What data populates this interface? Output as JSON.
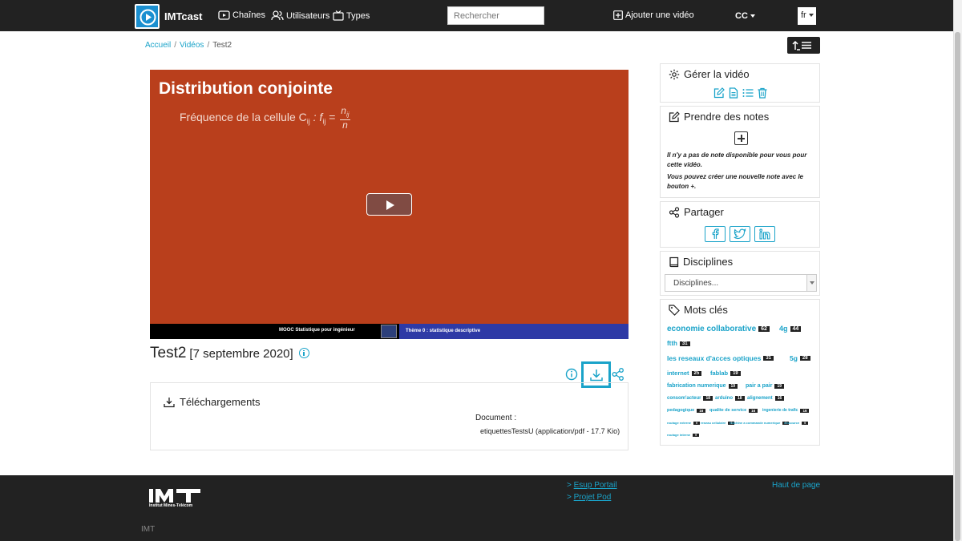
{
  "navbar": {
    "brand": "IMTcast",
    "links": [
      {
        "label": "Chaînes",
        "icon": "play-rectangle-icon"
      },
      {
        "label": "Utilisateurs",
        "icon": "users-icon"
      },
      {
        "label": "Types",
        "icon": "tv-icon"
      }
    ],
    "search_placeholder": "Rechercher",
    "add_video": "Ajouter une vidéo",
    "cc": "CC",
    "lang": "fr"
  },
  "breadcrumb": {
    "items": [
      "Accueil",
      "Vidéos",
      "Test2"
    ],
    "sep": "/"
  },
  "video": {
    "slide_title": "Distribution conjointe",
    "slide_subtitle": "Fréquence de la cellule C",
    "slide_subscript": "ij",
    "slide_formula_f": ": f",
    "slide_formula_eq": "=",
    "slide_num": "n",
    "slide_num_sub": "ij",
    "slide_den": "n",
    "bar_left": "MOOC Statistique pour ingénieur",
    "bar_right": "Thème 0 : statistique descriptive",
    "title": "Test2",
    "date": "[7 septembre 2020]"
  },
  "downloads": {
    "title": "Téléchargements",
    "doc_label": "Document :",
    "doc_file": "etiquettesTestsU (application/pdf - 17.7 Kio)"
  },
  "sidebar": {
    "manage": {
      "title": "Gérer la vidéo"
    },
    "notes": {
      "title": "Prendre des notes",
      "text1": "Il n'y a pas de note disponible pour vous pour cette vidéo.",
      "text2": "Vous pouvez créer une nouvelle note avec le bouton +."
    },
    "share": {
      "title": "Partager"
    },
    "disciplines": {
      "title": "Disciplines",
      "select": "Disciplines..."
    },
    "keywords": {
      "title": "Mots clés",
      "tags": [
        {
          "label": "economie collaborative",
          "count": "62"
        },
        {
          "label": "4g",
          "count": "44"
        },
        {
          "label": "ftth",
          "count": "31"
        },
        {
          "label": "les reseaux d'acces optiques",
          "count": "31"
        },
        {
          "label": "5g",
          "count": "28"
        },
        {
          "label": "internet",
          "count": "25"
        },
        {
          "label": "fablab",
          "count": "19"
        },
        {
          "label": "fabrication numerique",
          "count": "19"
        },
        {
          "label": "pair a pair",
          "count": "19"
        },
        {
          "label": "consom'acteur",
          "count": "18"
        },
        {
          "label": "arduino",
          "count": "18"
        },
        {
          "label": "alignement",
          "count": "16"
        },
        {
          "label": "pedagogique",
          "count": "16"
        },
        {
          "label": "qualite de service",
          "count": "16"
        },
        {
          "label": "ingenierie de trafic",
          "count": "16"
        },
        {
          "label": "routage externe",
          "count": "9"
        },
        {
          "label": "reseau cellulaire",
          "count": "9"
        },
        {
          "label": "machine a commande numerique",
          "count": "9"
        },
        {
          "label": "ressource",
          "count": "9"
        },
        {
          "label": "routage interne",
          "count": "9"
        }
      ]
    }
  },
  "footer": {
    "logo_sub": "Institut Mines-Télécom",
    "links": [
      {
        "prefix": "> ",
        "label": "Esup Portail"
      },
      {
        "prefix": "> ",
        "label": "Projet Pod"
      }
    ],
    "top": "Haut de page",
    "org": "IMT"
  },
  "colors": {
    "accent": "#1aa3c9",
    "dark": "#222222",
    "video_bg": "#b93f1c",
    "bar_blue": "#2e3aa6"
  }
}
